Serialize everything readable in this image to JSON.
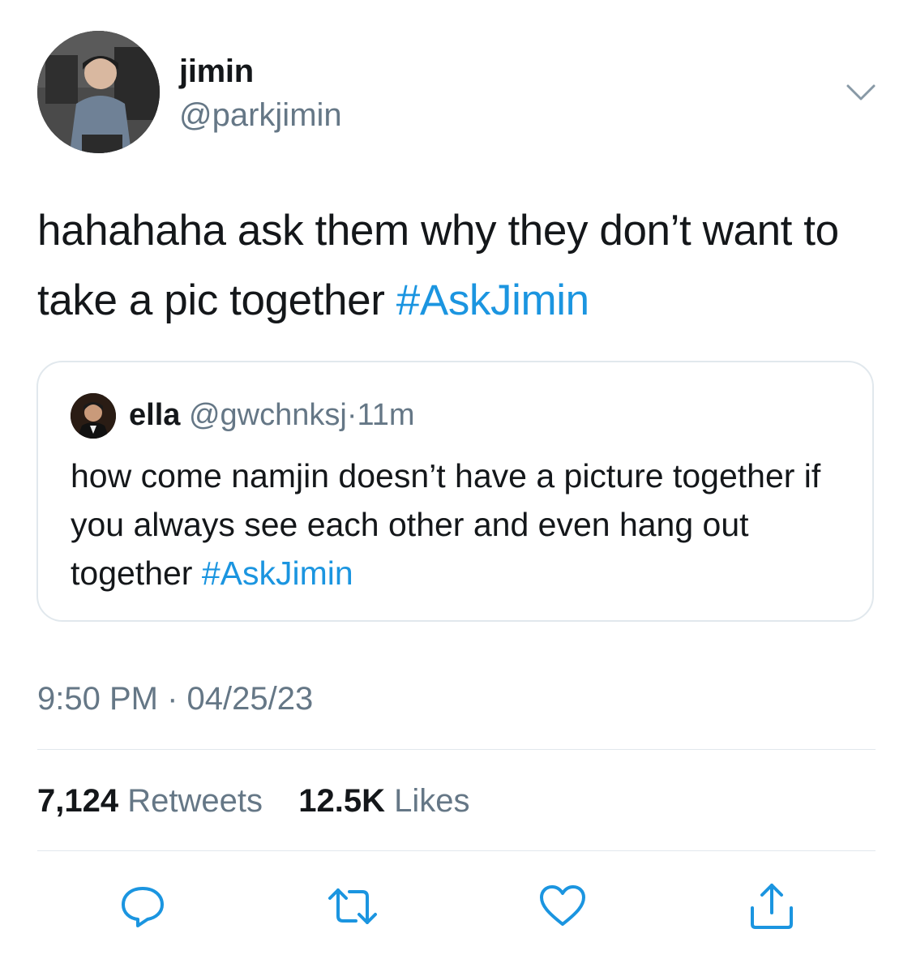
{
  "tweet": {
    "author": {
      "display_name": "jimin",
      "handle": "@parkjimin",
      "avatar_icon": "profile-photo"
    },
    "text": "hahahaha ask them why they don’t want to take a pic together",
    "hashtag": "#AskJimin",
    "quoted": {
      "display_name": "ella",
      "handle": "@gwchnksj",
      "separator": "·",
      "time": "11m",
      "text": "how come namjin doesn’t have a picture together if you always see each other and even hang out together",
      "hashtag": "#AskJimin"
    },
    "timestamp": "9:50 PM · 04/25/23",
    "stats": {
      "retweets_count": "7,124",
      "retweets_label": "Retweets",
      "likes_count": "12.5K",
      "likes_label": "Likes"
    },
    "actions": [
      "reply-icon",
      "retweet-icon",
      "like-icon",
      "share-icon"
    ]
  },
  "colors": {
    "text": "#14171a",
    "secondary": "#657786",
    "link": "#1b95e0",
    "border": "#e1e8ed"
  }
}
